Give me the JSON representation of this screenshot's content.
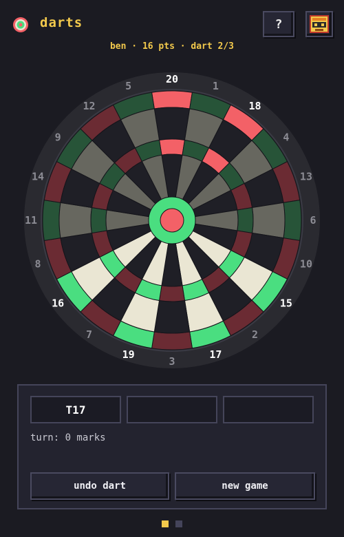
{
  "app": {
    "title": "darts"
  },
  "status": "ben · 16 pts · dart 2/3",
  "header": {
    "help_label": "?"
  },
  "board": {
    "numbers": [
      "20",
      "1",
      "18",
      "4",
      "13",
      "6",
      "10",
      "15",
      "2",
      "17",
      "3",
      "19",
      "7",
      "16",
      "8",
      "11",
      "14",
      "9",
      "12",
      "5"
    ],
    "highlighted_numbers": [
      "20",
      "18",
      "15",
      "17",
      "19",
      "16"
    ],
    "colors": {
      "dark": "#1f1f26",
      "light": "#67675f",
      "red": "#6b2b33",
      "green": "#275438",
      "hit_red": "#f36167",
      "hit_light": "#eae6d3",
      "hit_green": "#4ade80",
      "surround": "#2a2a30",
      "number": "#8c8c94",
      "number_hit": "#ffffff"
    },
    "marked_segments": [
      {
        "number": "20",
        "ring": "triple"
      },
      {
        "number": "20",
        "ring": "double"
      },
      {
        "number": "18",
        "ring": "triple"
      },
      {
        "number": "18",
        "ring": "double"
      },
      {
        "number": "15",
        "ring": "double"
      },
      {
        "number": "15",
        "ring": "triple"
      },
      {
        "number": "15",
        "ring": "single"
      },
      {
        "number": "17",
        "ring": "double"
      },
      {
        "number": "17",
        "ring": "triple"
      },
      {
        "number": "17",
        "ring": "single"
      },
      {
        "number": "19",
        "ring": "double"
      },
      {
        "number": "19",
        "ring": "triple"
      },
      {
        "number": "19",
        "ring": "single"
      },
      {
        "number": "16",
        "ring": "double"
      },
      {
        "number": "16",
        "ring": "triple"
      },
      {
        "number": "16",
        "ring": "single"
      },
      {
        "number": "bull",
        "ring": "outer"
      },
      {
        "number": "bull",
        "ring": "inner"
      }
    ]
  },
  "throws": [
    "T17",
    "",
    ""
  ],
  "turn_text": "turn: 0 marks",
  "buttons": {
    "undo": "undo dart",
    "new_game": "new game"
  },
  "pagination": {
    "pages": 2,
    "active": 1,
    "colors": {
      "active": "#f2c94c",
      "inactive": "#44445a"
    }
  }
}
